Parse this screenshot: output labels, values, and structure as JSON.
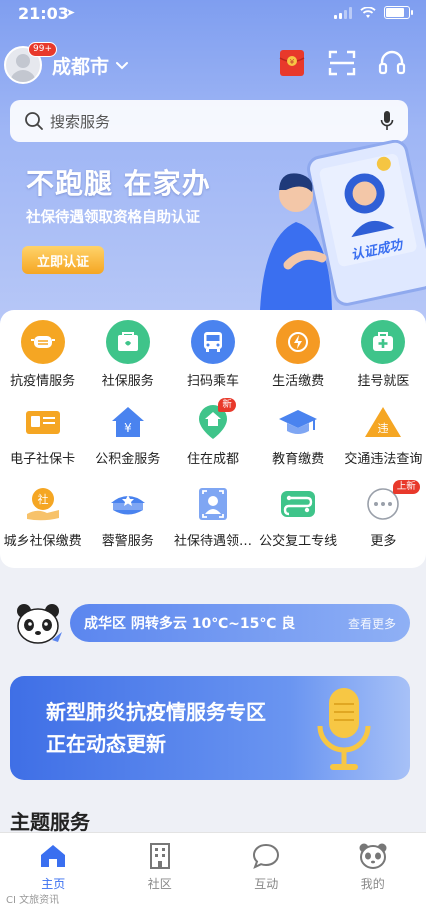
{
  "status": {
    "time": "21:03",
    "battery_level": 0.9
  },
  "header": {
    "city": "成都市",
    "message_count": "99+"
  },
  "search": {
    "placeholder": "搜索服务"
  },
  "banner": {
    "title": "不跑腿 在家办",
    "subtitle": "社保待遇领取资格自助认证",
    "button": "立即认证",
    "art_text": "认证成功"
  },
  "services": [
    {
      "label": "抗疫情服务",
      "icon": "mask-icon",
      "color": "#f5a623"
    },
    {
      "label": "社保服务",
      "icon": "social-security-icon",
      "color": "#3fc48a"
    },
    {
      "label": "扫码乘车",
      "icon": "bus-icon",
      "color": "#4a83ef"
    },
    {
      "label": "生活缴费",
      "icon": "lightning-icon",
      "color": "#f59a23"
    },
    {
      "label": "挂号就医",
      "icon": "medical-kit-icon",
      "color": "#3fc48a"
    },
    {
      "label": "电子社保卡",
      "icon": "id-card-icon",
      "color": "#f5a623"
    },
    {
      "label": "公积金服务",
      "icon": "housing-fund-icon",
      "color": "#4a83ef"
    },
    {
      "label": "住在成都",
      "icon": "house-location-icon",
      "color": "#3fc48a",
      "tag": "新"
    },
    {
      "label": "教育缴费",
      "icon": "graduation-cap-icon",
      "color": "#4a83ef"
    },
    {
      "label": "交通违法查询",
      "icon": "traffic-warning-icon",
      "color": "#f5a623",
      "glyph": "违"
    },
    {
      "label": "城乡社保缴费",
      "icon": "coin-hand-icon",
      "color": "#f5a623",
      "glyph": "社"
    },
    {
      "label": "蓉警服务",
      "icon": "police-cap-icon",
      "color": "#4a83ef"
    },
    {
      "label": "社保待遇领…",
      "icon": "face-verify-icon",
      "color": "#4a83ef"
    },
    {
      "label": "公交复工专线",
      "icon": "bus-route-icon",
      "color": "#3fc48a"
    },
    {
      "label": "更多",
      "icon": "more-icon",
      "color": "#9aa0aa",
      "tag": "上新"
    }
  ],
  "weather": {
    "text": "成华区  阴转多云  10℃~15℃  良",
    "more": "查看更多"
  },
  "epidemic": {
    "line1": "新型肺炎抗疫情服务专区",
    "line2": "正在动态更新"
  },
  "section": {
    "title": "主题服务"
  },
  "nav": [
    {
      "label": "主页",
      "icon": "home-icon",
      "active": true
    },
    {
      "label": "社区",
      "icon": "building-icon",
      "active": false
    },
    {
      "label": "互动",
      "icon": "chat-bubble-icon",
      "active": false
    },
    {
      "label": "我的",
      "icon": "panda-face-icon",
      "active": false
    }
  ],
  "watermark": "CI 文旅资讯"
}
